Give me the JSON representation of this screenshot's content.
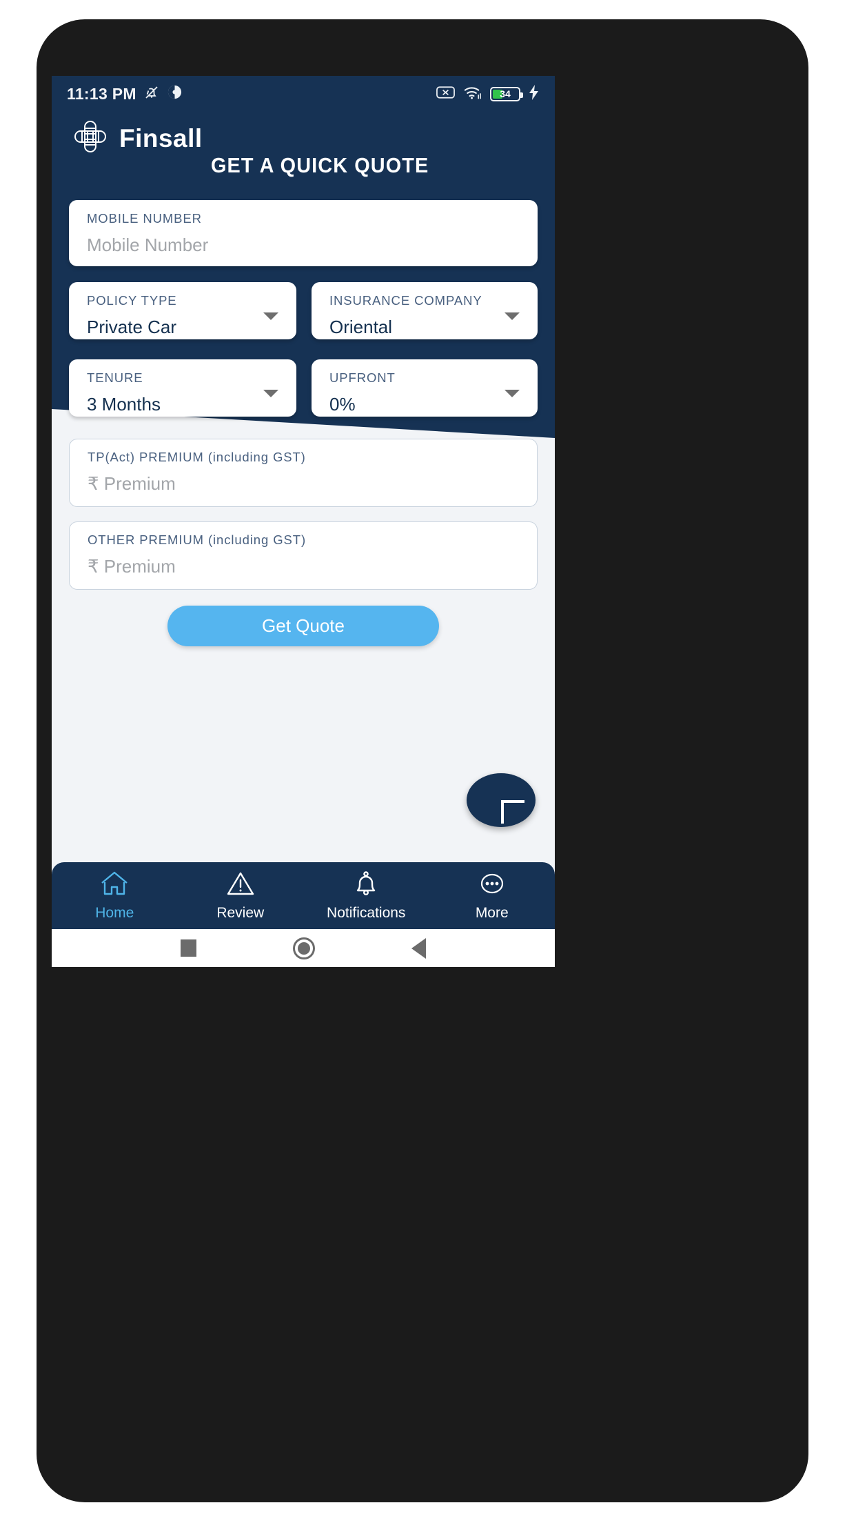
{
  "status_bar": {
    "time": "11:13 PM",
    "icons_left": [
      "bell-muted-icon",
      "theme-contrast-icon"
    ],
    "icons_right": [
      "no-sim-icon",
      "wifi-icon",
      "battery-icon",
      "charging-bolt-icon"
    ],
    "battery_percent": "34"
  },
  "header": {
    "logo_icon": "finsall-logo-icon",
    "brand": "Finsall",
    "title": "GET A QUICK QUOTE",
    "background_color": "#163254"
  },
  "form": {
    "mobile": {
      "label": "MOBILE NUMBER",
      "value": "",
      "placeholder": "Mobile Number"
    },
    "policy_type": {
      "label": "POLICY TYPE",
      "value": "Private Car"
    },
    "insurance_company": {
      "label": "INSURANCE COMPANY",
      "value": "Oriental"
    },
    "tenure": {
      "label": "TENURE",
      "value": "3 Months"
    },
    "upfront": {
      "label": "UPFRONT",
      "value": "0%"
    },
    "tp_premium": {
      "label": "TP(Act) PREMIUM (including GST)",
      "value": "",
      "placeholder": "₹ Premium"
    },
    "other_premium": {
      "label": "OTHER PREMIUM (including GST)",
      "value": "",
      "placeholder": "₹ Premium"
    },
    "submit_label": "Get Quote",
    "submit_color": "#55b5ef"
  },
  "fab": {
    "icon": "plus-icon",
    "color": "#163254"
  },
  "bottom_nav": {
    "active_color": "#4fb4e8",
    "items": [
      {
        "label": "Home",
        "icon": "home-icon",
        "active": true
      },
      {
        "label": "Review",
        "icon": "warning-triangle-icon",
        "active": false
      },
      {
        "label": "Notifications",
        "icon": "bell-icon",
        "active": false
      },
      {
        "label": "More",
        "icon": "more-dots-circle-icon",
        "active": false
      }
    ]
  },
  "system_bar": {
    "buttons": [
      "recents-square-icon",
      "home-circle-icon",
      "back-triangle-icon"
    ]
  }
}
